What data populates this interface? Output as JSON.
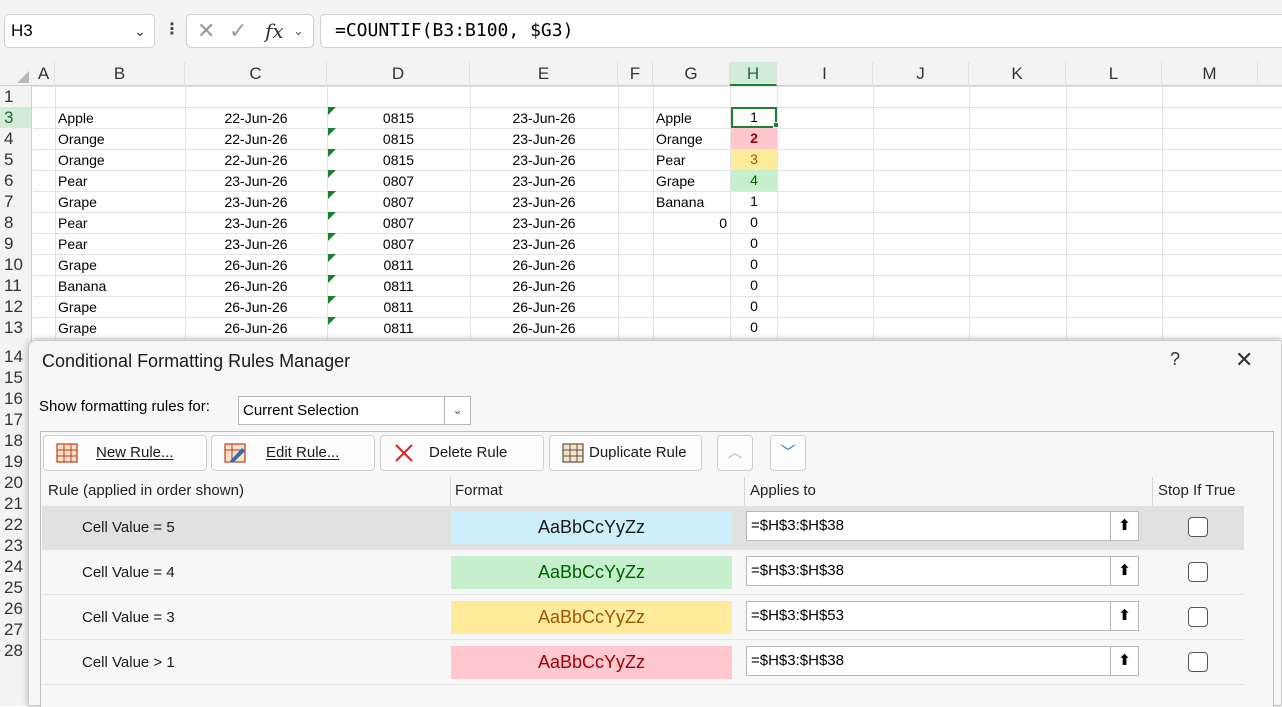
{
  "formula_bar": {
    "name_box": "H3",
    "cancel_glyph": "✕",
    "enter_glyph": "✓",
    "fx_label": "fx",
    "formula": "=COUNTIF(B3:B100, $G3)"
  },
  "columns": [
    "A",
    "B",
    "C",
    "D",
    "E",
    "F",
    "G",
    "H",
    "I",
    "J",
    "K",
    "L",
    "M"
  ],
  "active_column": "H",
  "row_numbers": [
    "1",
    "2",
    "3",
    "4",
    "5",
    "6",
    "7",
    "8",
    "9",
    "10",
    "11",
    "12",
    "13",
    "14",
    "15",
    "16",
    "17",
    "18",
    "19",
    "20",
    "21",
    "22",
    "23",
    "24",
    "25",
    "26",
    "27",
    "28"
  ],
  "active_row": "3",
  "sheet_rows": [
    {
      "b": "Apple",
      "c": "22-Jun-26",
      "d": "0815",
      "e": "23-Jun-26",
      "g": "Apple",
      "h": "1",
      "h_style": "sel"
    },
    {
      "b": "Orange",
      "c": "22-Jun-26",
      "d": "0815",
      "e": "23-Jun-26",
      "g": "Orange",
      "h": "2",
      "h_style": "red"
    },
    {
      "b": "Orange",
      "c": "22-Jun-26",
      "d": "0815",
      "e": "23-Jun-26",
      "g": "Pear",
      "h": "3",
      "h_style": "yellow"
    },
    {
      "b": "Pear",
      "c": "23-Jun-26",
      "d": "0807",
      "e": "23-Jun-26",
      "g": "Grape",
      "h": "4",
      "h_style": "green"
    },
    {
      "b": "Grape",
      "c": "23-Jun-26",
      "d": "0807",
      "e": "23-Jun-26",
      "g": "Banana",
      "h": "1",
      "h_style": ""
    },
    {
      "b": "Pear",
      "c": "23-Jun-26",
      "d": "0807",
      "e": "23-Jun-26",
      "g_num": "0",
      "h": "0",
      "h_style": ""
    },
    {
      "b": "Pear",
      "c": "23-Jun-26",
      "d": "0807",
      "e": "23-Jun-26",
      "h": "0",
      "h_style": ""
    },
    {
      "b": "Grape",
      "c": "26-Jun-26",
      "d": "0811",
      "e": "26-Jun-26",
      "h": "0",
      "h_style": ""
    },
    {
      "b": "Banana",
      "c": "26-Jun-26",
      "d": "0811",
      "e": "26-Jun-26",
      "h": "0",
      "h_style": ""
    },
    {
      "b": "Grape",
      "c": "26-Jun-26",
      "d": "0811",
      "e": "26-Jun-26",
      "h": "0",
      "h_style": ""
    },
    {
      "b": "Grape",
      "c": "26-Jun-26",
      "d": "0811",
      "e": "26-Jun-26",
      "h": "0",
      "h_style": ""
    }
  ],
  "dialog": {
    "title": "Conditional Formatting Rules Manager",
    "help": "?",
    "close": "✕",
    "show_label": "Show formatting rules for:",
    "show_value": "Current Selection",
    "buttons": {
      "new_rule": "New Rule...",
      "edit_rule": "Edit Rule...",
      "delete_rule": "Delete Rule",
      "duplicate_rule": "Duplicate Rule",
      "move_up": "︿",
      "move_down": "﹀"
    },
    "headers": {
      "rule": "Rule (applied in order shown)",
      "format": "Format",
      "applies_to": "Applies to",
      "stop_if_true": "Stop If True"
    },
    "rules": [
      {
        "name": "Cell Value = 5",
        "preview": "AaBbCcYyZz",
        "applies_to": "=$H$3:$H$38",
        "fill": "#cdeefb",
        "text_color": "#1a1a1a",
        "stop_if_true": false,
        "selected": true
      },
      {
        "name": "Cell Value = 4",
        "preview": "AaBbCcYyZz",
        "applies_to": "=$H$3:$H$38",
        "fill": "#c6efce",
        "text_color": "#006100",
        "stop_if_true": false,
        "selected": false
      },
      {
        "name": "Cell Value = 3",
        "preview": "AaBbCcYyZz",
        "applies_to": "=$H$3:$H$53",
        "fill": "#ffeb9c",
        "text_color": "#9c5700",
        "stop_if_true": false,
        "selected": false
      },
      {
        "name": "Cell Value > 1",
        "preview": "AaBbCcYyZz",
        "applies_to": "=$H$3:$H$38",
        "fill": "#ffc7ce",
        "text_color": "#9c0006",
        "stop_if_true": false,
        "selected": false
      }
    ]
  }
}
